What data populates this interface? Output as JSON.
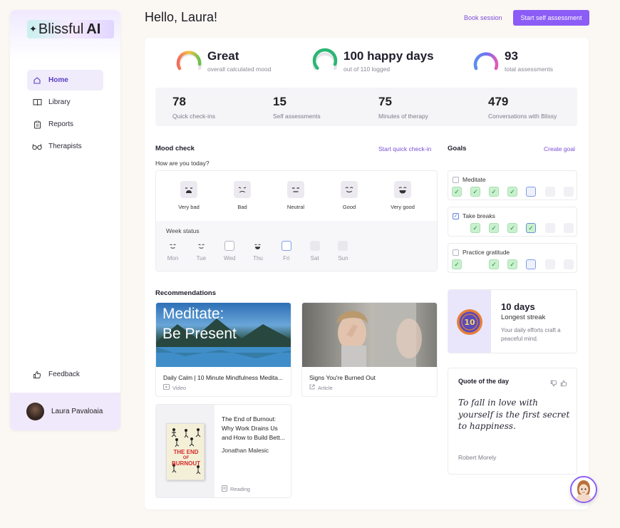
{
  "sidebar": {
    "logo_text": "Blissful",
    "logo_ai": "AI",
    "nav": [
      {
        "label": "Home",
        "icon": "home-icon",
        "active": true
      },
      {
        "label": "Library",
        "icon": "book-icon",
        "active": false
      },
      {
        "label": "Reports",
        "icon": "clipboard-icon",
        "active": false
      },
      {
        "label": "Therapists",
        "icon": "glasses-icon",
        "active": false
      }
    ],
    "feedback_label": "Feedback",
    "user_name": "Laura Pavaloaia"
  },
  "header": {
    "greeting": "Hello, Laura!",
    "book_session": "Book session",
    "start_assessment": "Start self assessment"
  },
  "kpis": [
    {
      "value": "Great",
      "label": "overall calculated mood"
    },
    {
      "value": "100 happy days",
      "label": "out of 110 logged"
    },
    {
      "value": "93",
      "label": "total assessments"
    }
  ],
  "stats": [
    {
      "value": "78",
      "label": "Quick check-ins"
    },
    {
      "value": "15",
      "label": "Self assessments"
    },
    {
      "value": "75",
      "label": "Minutes of therapy"
    },
    {
      "value": "479",
      "label": "Conversations with Blissy"
    }
  ],
  "mood": {
    "title": "Mood check",
    "link": "Start quick check-in",
    "question": "How are you today?",
    "options": [
      {
        "label": "Very bad",
        "glyph": "😩"
      },
      {
        "label": "Bad",
        "glyph": "☹"
      },
      {
        "label": "Neutral",
        "glyph": "😑"
      },
      {
        "label": "Good",
        "glyph": "☺"
      },
      {
        "label": "Very good",
        "glyph": "😁"
      }
    ],
    "week_title": "Week status",
    "days": [
      {
        "label": "Mon",
        "state": "good"
      },
      {
        "label": "Tue",
        "state": "good"
      },
      {
        "label": "Wed",
        "state": "empty"
      },
      {
        "label": "Thu",
        "state": "verygood"
      },
      {
        "label": "Fri",
        "state": "today"
      },
      {
        "label": "Sat",
        "state": "future"
      },
      {
        "label": "Sun",
        "state": "future"
      }
    ]
  },
  "goals": {
    "title": "Goals",
    "link": "Create goal",
    "items": [
      {
        "label": "Meditate",
        "checked": false,
        "days": [
          "done",
          "done",
          "done",
          "done",
          "today",
          "empty",
          "empty"
        ]
      },
      {
        "label": "Take breaks",
        "checked": true,
        "days": [
          "none",
          "done",
          "done",
          "done",
          "todaydone",
          "empty",
          "empty"
        ]
      },
      {
        "label": "Practice gratitude",
        "checked": false,
        "days": [
          "done",
          "none",
          "done",
          "done",
          "today",
          "empty",
          "empty"
        ]
      }
    ]
  },
  "recommendations": {
    "title": "Recommendations",
    "items": [
      {
        "title": "Daily Calm | 10 Minute Mindfulness Medita...",
        "type": "Video",
        "overlay": [
          "Meditate:",
          "Be Present"
        ]
      },
      {
        "title": "Signs You're Burned Out",
        "type": "Article"
      }
    ],
    "book": {
      "title": "The End of Burnout: Why Work Drains Us and How to Build Bett...",
      "author": "Jonathan Malesic",
      "type": "Reading",
      "cover_text": [
        "THE END",
        "OF",
        "BURNOUT"
      ]
    }
  },
  "streak": {
    "value": "10 days",
    "label": "Longest streak",
    "desc": "Your daily efforts craft a peaceful mind.",
    "badge": "10"
  },
  "quote": {
    "title": "Quote of the day",
    "text": "To fall in love with yourself is the first secret to happiness.",
    "author": "Robert Morely"
  },
  "colors": {
    "accent": "#8b5cf6",
    "mood_gauge": "#f5a623",
    "happy_gauge": "#2bb673",
    "assess_gauge": "#5b8def"
  },
  "progress": {
    "happy_days_fraction": 0.909
  }
}
